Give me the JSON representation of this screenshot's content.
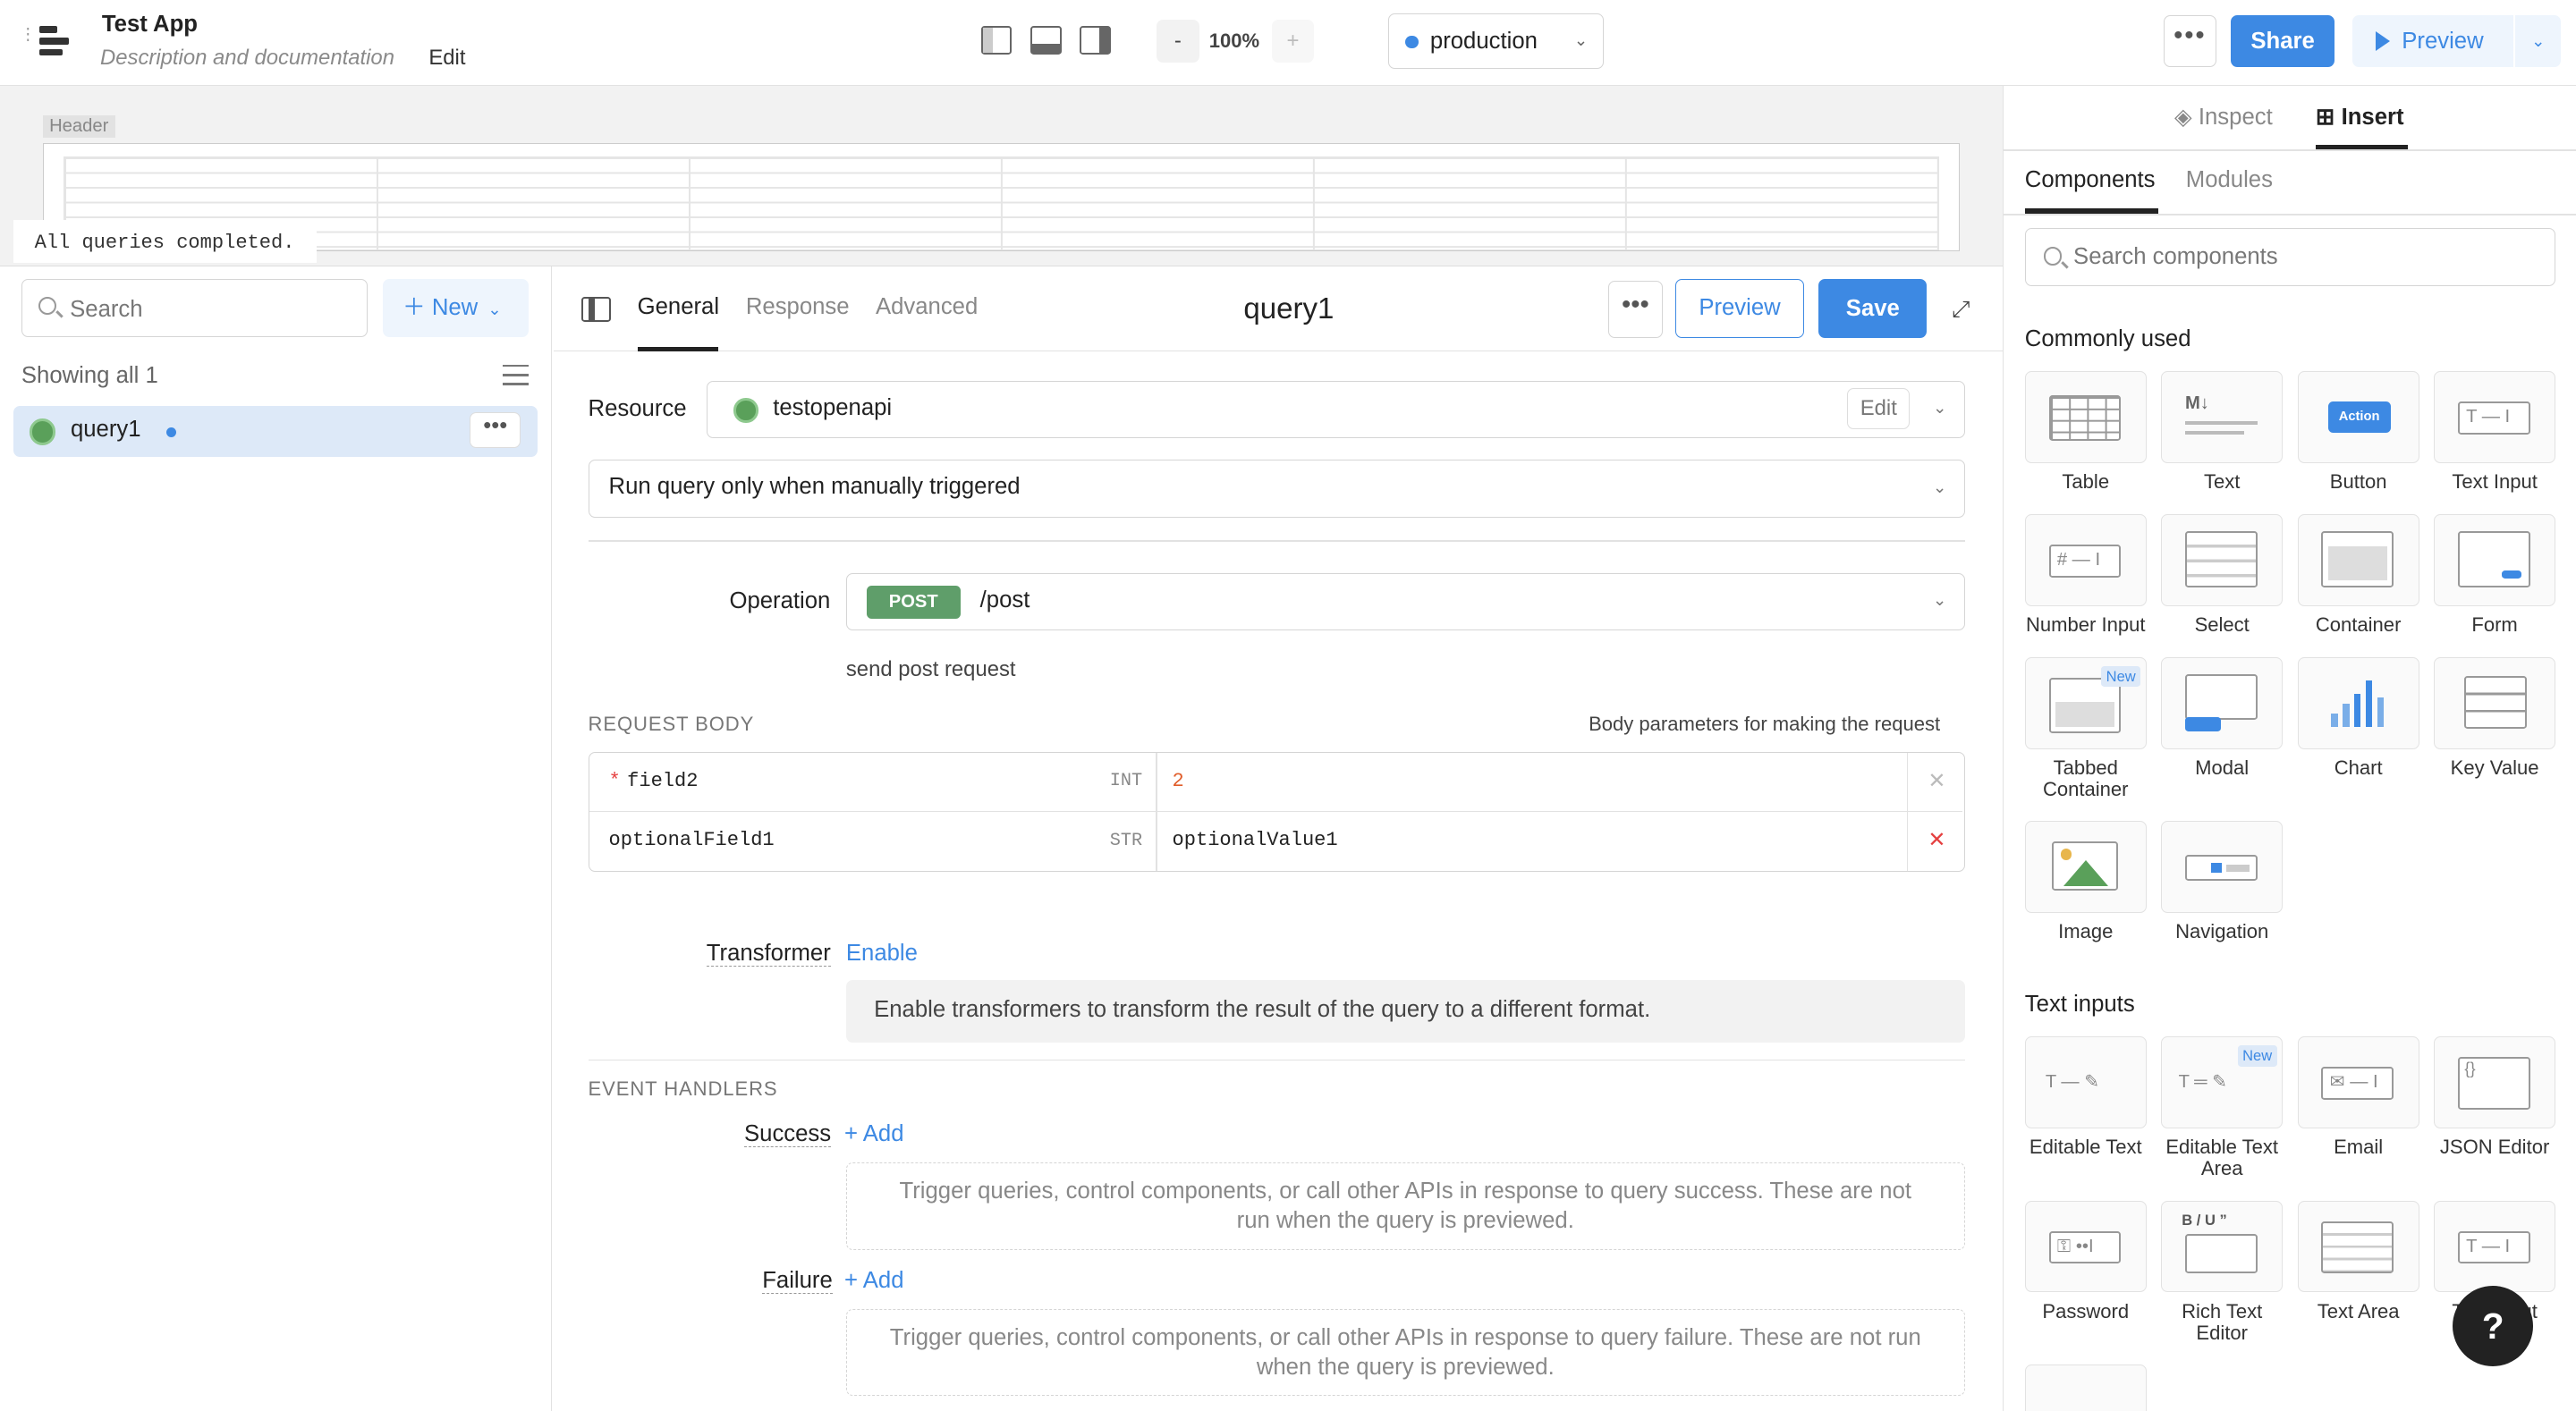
{
  "app": {
    "title": "Test App",
    "description": "Description and documentation",
    "edit": "Edit"
  },
  "toolbar": {
    "zoom_minus": "-",
    "zoom": "100%",
    "zoom_plus": "+",
    "environment": "production",
    "more": "•••",
    "share": "Share",
    "preview": "Preview"
  },
  "canvas": {
    "header_tag": "Header",
    "status": "All queries completed."
  },
  "queries": {
    "search_placeholder": "Search",
    "new_label": "New",
    "showing": "Showing all 1",
    "items": [
      {
        "name": "query1",
        "more": "•••"
      }
    ]
  },
  "editor": {
    "tabs": [
      "General",
      "Response",
      "Advanced"
    ],
    "title": "query1",
    "more": "•••",
    "preview": "Preview",
    "save": "Save",
    "resource_label": "Resource",
    "resource": "testopenapi",
    "resource_edit": "Edit",
    "trigger": "Run query only when manually triggered",
    "operation_label": "Operation",
    "method": "POST",
    "path": "/post",
    "operation_desc": "send post request",
    "request_body_title": "REQUEST BODY",
    "request_body_hint": "Body parameters for making the request",
    "params": [
      {
        "key": "field2",
        "required": true,
        "type": "INT",
        "value": "2"
      },
      {
        "key": "optionalField1",
        "required": false,
        "type": "STR",
        "value": "optionalValue1"
      }
    ],
    "transformer_label": "Transformer",
    "transformer_action": "Enable",
    "transformer_info": "Enable transformers to transform the result of the query to a different format.",
    "event_handlers_title": "EVENT HANDLERS",
    "success_label": "Success",
    "failure_label": "Failure",
    "add_label": "+ Add",
    "success_info": "Trigger queries, control components, or call other APIs in response to query success. These are not run when the query is previewed.",
    "failure_info": "Trigger queries, control components, or call other APIs in response to query failure. These are not run when the query is previewed."
  },
  "inspector": {
    "tabs": [
      "Inspect",
      "Insert"
    ],
    "subtabs": [
      "Components",
      "Modules"
    ],
    "search_placeholder": "Search components",
    "commonly_used_title": "Commonly used",
    "commonly_used": [
      "Table",
      "Text",
      "Button",
      "Text Input",
      "Number Input",
      "Select",
      "Container",
      "Form",
      "Tabbed Container",
      "Modal",
      "Chart",
      "Key Value",
      "Image",
      "Navigation"
    ],
    "new_badge": "New",
    "action_badge": "Action",
    "text_inputs_title": "Text inputs",
    "text_inputs": [
      "Editable Text",
      "Editable Text Area",
      "Email",
      "JSON Editor",
      "Password",
      "Rich Text Editor",
      "Text Area",
      "Text Input"
    ],
    "help": "?"
  },
  "colors": {
    "accent": "#3d89e3",
    "post": "#5f9e6a",
    "required": "#e54040"
  }
}
